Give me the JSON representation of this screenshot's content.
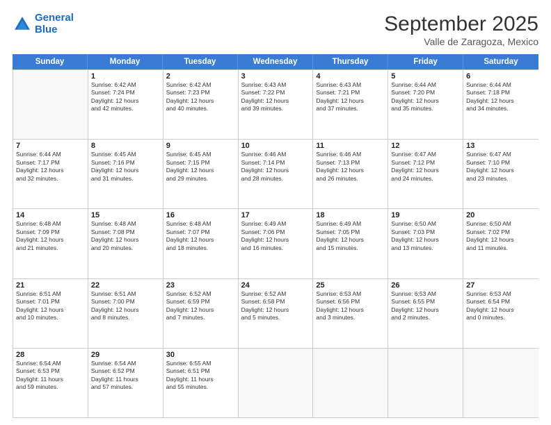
{
  "header": {
    "logo_line1": "General",
    "logo_line2": "Blue",
    "title": "September 2025",
    "subtitle": "Valle de Zaragoza, Mexico"
  },
  "weekdays": [
    "Sunday",
    "Monday",
    "Tuesday",
    "Wednesday",
    "Thursday",
    "Friday",
    "Saturday"
  ],
  "weeks": [
    [
      {
        "day": "",
        "info": ""
      },
      {
        "day": "1",
        "info": "Sunrise: 6:42 AM\nSunset: 7:24 PM\nDaylight: 12 hours\nand 42 minutes."
      },
      {
        "day": "2",
        "info": "Sunrise: 6:42 AM\nSunset: 7:23 PM\nDaylight: 12 hours\nand 40 minutes."
      },
      {
        "day": "3",
        "info": "Sunrise: 6:43 AM\nSunset: 7:22 PM\nDaylight: 12 hours\nand 39 minutes."
      },
      {
        "day": "4",
        "info": "Sunrise: 6:43 AM\nSunset: 7:21 PM\nDaylight: 12 hours\nand 37 minutes."
      },
      {
        "day": "5",
        "info": "Sunrise: 6:44 AM\nSunset: 7:20 PM\nDaylight: 12 hours\nand 35 minutes."
      },
      {
        "day": "6",
        "info": "Sunrise: 6:44 AM\nSunset: 7:18 PM\nDaylight: 12 hours\nand 34 minutes."
      }
    ],
    [
      {
        "day": "7",
        "info": "Sunrise: 6:44 AM\nSunset: 7:17 PM\nDaylight: 12 hours\nand 32 minutes."
      },
      {
        "day": "8",
        "info": "Sunrise: 6:45 AM\nSunset: 7:16 PM\nDaylight: 12 hours\nand 31 minutes."
      },
      {
        "day": "9",
        "info": "Sunrise: 6:45 AM\nSunset: 7:15 PM\nDaylight: 12 hours\nand 29 minutes."
      },
      {
        "day": "10",
        "info": "Sunrise: 6:46 AM\nSunset: 7:14 PM\nDaylight: 12 hours\nand 28 minutes."
      },
      {
        "day": "11",
        "info": "Sunrise: 6:46 AM\nSunset: 7:13 PM\nDaylight: 12 hours\nand 26 minutes."
      },
      {
        "day": "12",
        "info": "Sunrise: 6:47 AM\nSunset: 7:12 PM\nDaylight: 12 hours\nand 24 minutes."
      },
      {
        "day": "13",
        "info": "Sunrise: 6:47 AM\nSunset: 7:10 PM\nDaylight: 12 hours\nand 23 minutes."
      }
    ],
    [
      {
        "day": "14",
        "info": "Sunrise: 6:48 AM\nSunset: 7:09 PM\nDaylight: 12 hours\nand 21 minutes."
      },
      {
        "day": "15",
        "info": "Sunrise: 6:48 AM\nSunset: 7:08 PM\nDaylight: 12 hours\nand 20 minutes."
      },
      {
        "day": "16",
        "info": "Sunrise: 6:48 AM\nSunset: 7:07 PM\nDaylight: 12 hours\nand 18 minutes."
      },
      {
        "day": "17",
        "info": "Sunrise: 6:49 AM\nSunset: 7:06 PM\nDaylight: 12 hours\nand 16 minutes."
      },
      {
        "day": "18",
        "info": "Sunrise: 6:49 AM\nSunset: 7:05 PM\nDaylight: 12 hours\nand 15 minutes."
      },
      {
        "day": "19",
        "info": "Sunrise: 6:50 AM\nSunset: 7:03 PM\nDaylight: 12 hours\nand 13 minutes."
      },
      {
        "day": "20",
        "info": "Sunrise: 6:50 AM\nSunset: 7:02 PM\nDaylight: 12 hours\nand 11 minutes."
      }
    ],
    [
      {
        "day": "21",
        "info": "Sunrise: 6:51 AM\nSunset: 7:01 PM\nDaylight: 12 hours\nand 10 minutes."
      },
      {
        "day": "22",
        "info": "Sunrise: 6:51 AM\nSunset: 7:00 PM\nDaylight: 12 hours\nand 8 minutes."
      },
      {
        "day": "23",
        "info": "Sunrise: 6:52 AM\nSunset: 6:59 PM\nDaylight: 12 hours\nand 7 minutes."
      },
      {
        "day": "24",
        "info": "Sunrise: 6:52 AM\nSunset: 6:58 PM\nDaylight: 12 hours\nand 5 minutes."
      },
      {
        "day": "25",
        "info": "Sunrise: 6:53 AM\nSunset: 6:56 PM\nDaylight: 12 hours\nand 3 minutes."
      },
      {
        "day": "26",
        "info": "Sunrise: 6:53 AM\nSunset: 6:55 PM\nDaylight: 12 hours\nand 2 minutes."
      },
      {
        "day": "27",
        "info": "Sunrise: 6:53 AM\nSunset: 6:54 PM\nDaylight: 12 hours\nand 0 minutes."
      }
    ],
    [
      {
        "day": "28",
        "info": "Sunrise: 6:54 AM\nSunset: 6:53 PM\nDaylight: 11 hours\nand 59 minutes."
      },
      {
        "day": "29",
        "info": "Sunrise: 6:54 AM\nSunset: 6:52 PM\nDaylight: 11 hours\nand 57 minutes."
      },
      {
        "day": "30",
        "info": "Sunrise: 6:55 AM\nSunset: 6:51 PM\nDaylight: 11 hours\nand 55 minutes."
      },
      {
        "day": "",
        "info": ""
      },
      {
        "day": "",
        "info": ""
      },
      {
        "day": "",
        "info": ""
      },
      {
        "day": "",
        "info": ""
      }
    ]
  ]
}
